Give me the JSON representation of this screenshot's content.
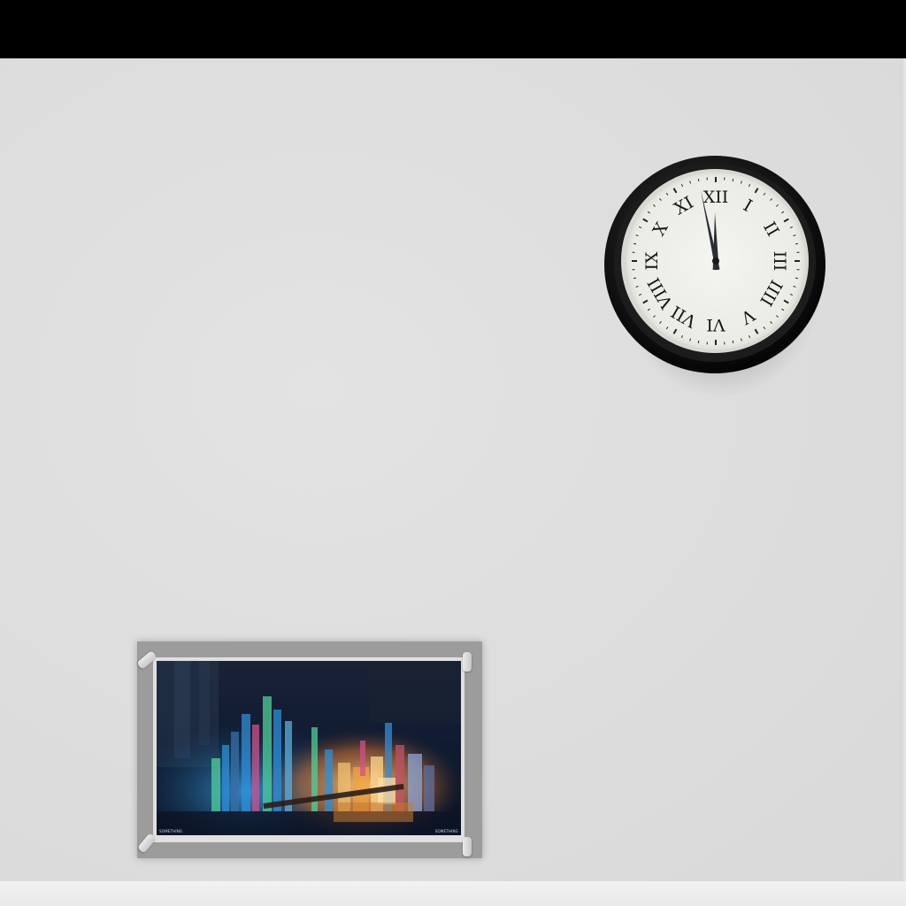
{
  "scene": {
    "wall_color": "#dedede",
    "top_bar_color": "#000000",
    "floor_color": "#eeeeee"
  },
  "clock": {
    "numerals": [
      "XII",
      "I",
      "II",
      "III",
      "IIII",
      "V",
      "VI",
      "VII",
      "VIII",
      "IX",
      "X",
      "XI"
    ],
    "hour": 11,
    "minute": 58,
    "rim_color": "#111111",
    "face_color": "#f0f0ec"
  },
  "painting": {
    "frame_color": "#9c9c9c",
    "caption_left": "SOMETHING",
    "caption_right": "SOMETHING",
    "palette": {
      "sky": "#0f1a2e",
      "glow_blue": "#2f8fd8",
      "glow_orange": "#f0a040",
      "glow_green": "#4fd09a",
      "glow_pink": "#d0508a"
    }
  }
}
